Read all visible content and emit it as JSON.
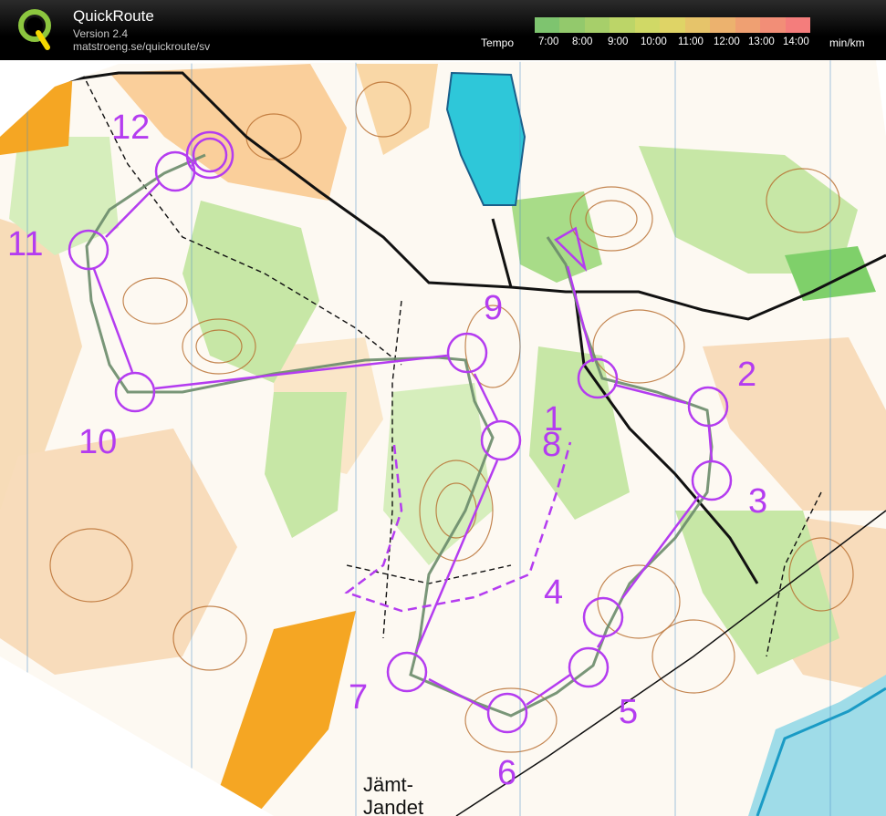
{
  "app": {
    "title": "QuickRoute",
    "version": "Version 2.4",
    "url": "matstroeng.se/quickroute/sv"
  },
  "legend": {
    "label": "Tempo",
    "unit": "min/km",
    "ticks": [
      "7:00",
      "8:00",
      "9:00",
      "10:00",
      "11:00",
      "12:00",
      "13:00",
      "14:00"
    ],
    "colors": [
      "#7ec46f",
      "#93c96c",
      "#a7cf6a",
      "#bcd568",
      "#d0d966",
      "#dfd466",
      "#e6c46a",
      "#ecb26e",
      "#efa072",
      "#f28e77",
      "#f47d7c"
    ]
  },
  "course": {
    "color": "#b43cf0",
    "controls": [
      "1",
      "2",
      "3",
      "4",
      "5",
      "6",
      "7",
      "8",
      "9",
      "10",
      "11",
      "12"
    ]
  },
  "map": {
    "place_name_line1": "Jämt-",
    "place_name_line2": "Jandet"
  }
}
